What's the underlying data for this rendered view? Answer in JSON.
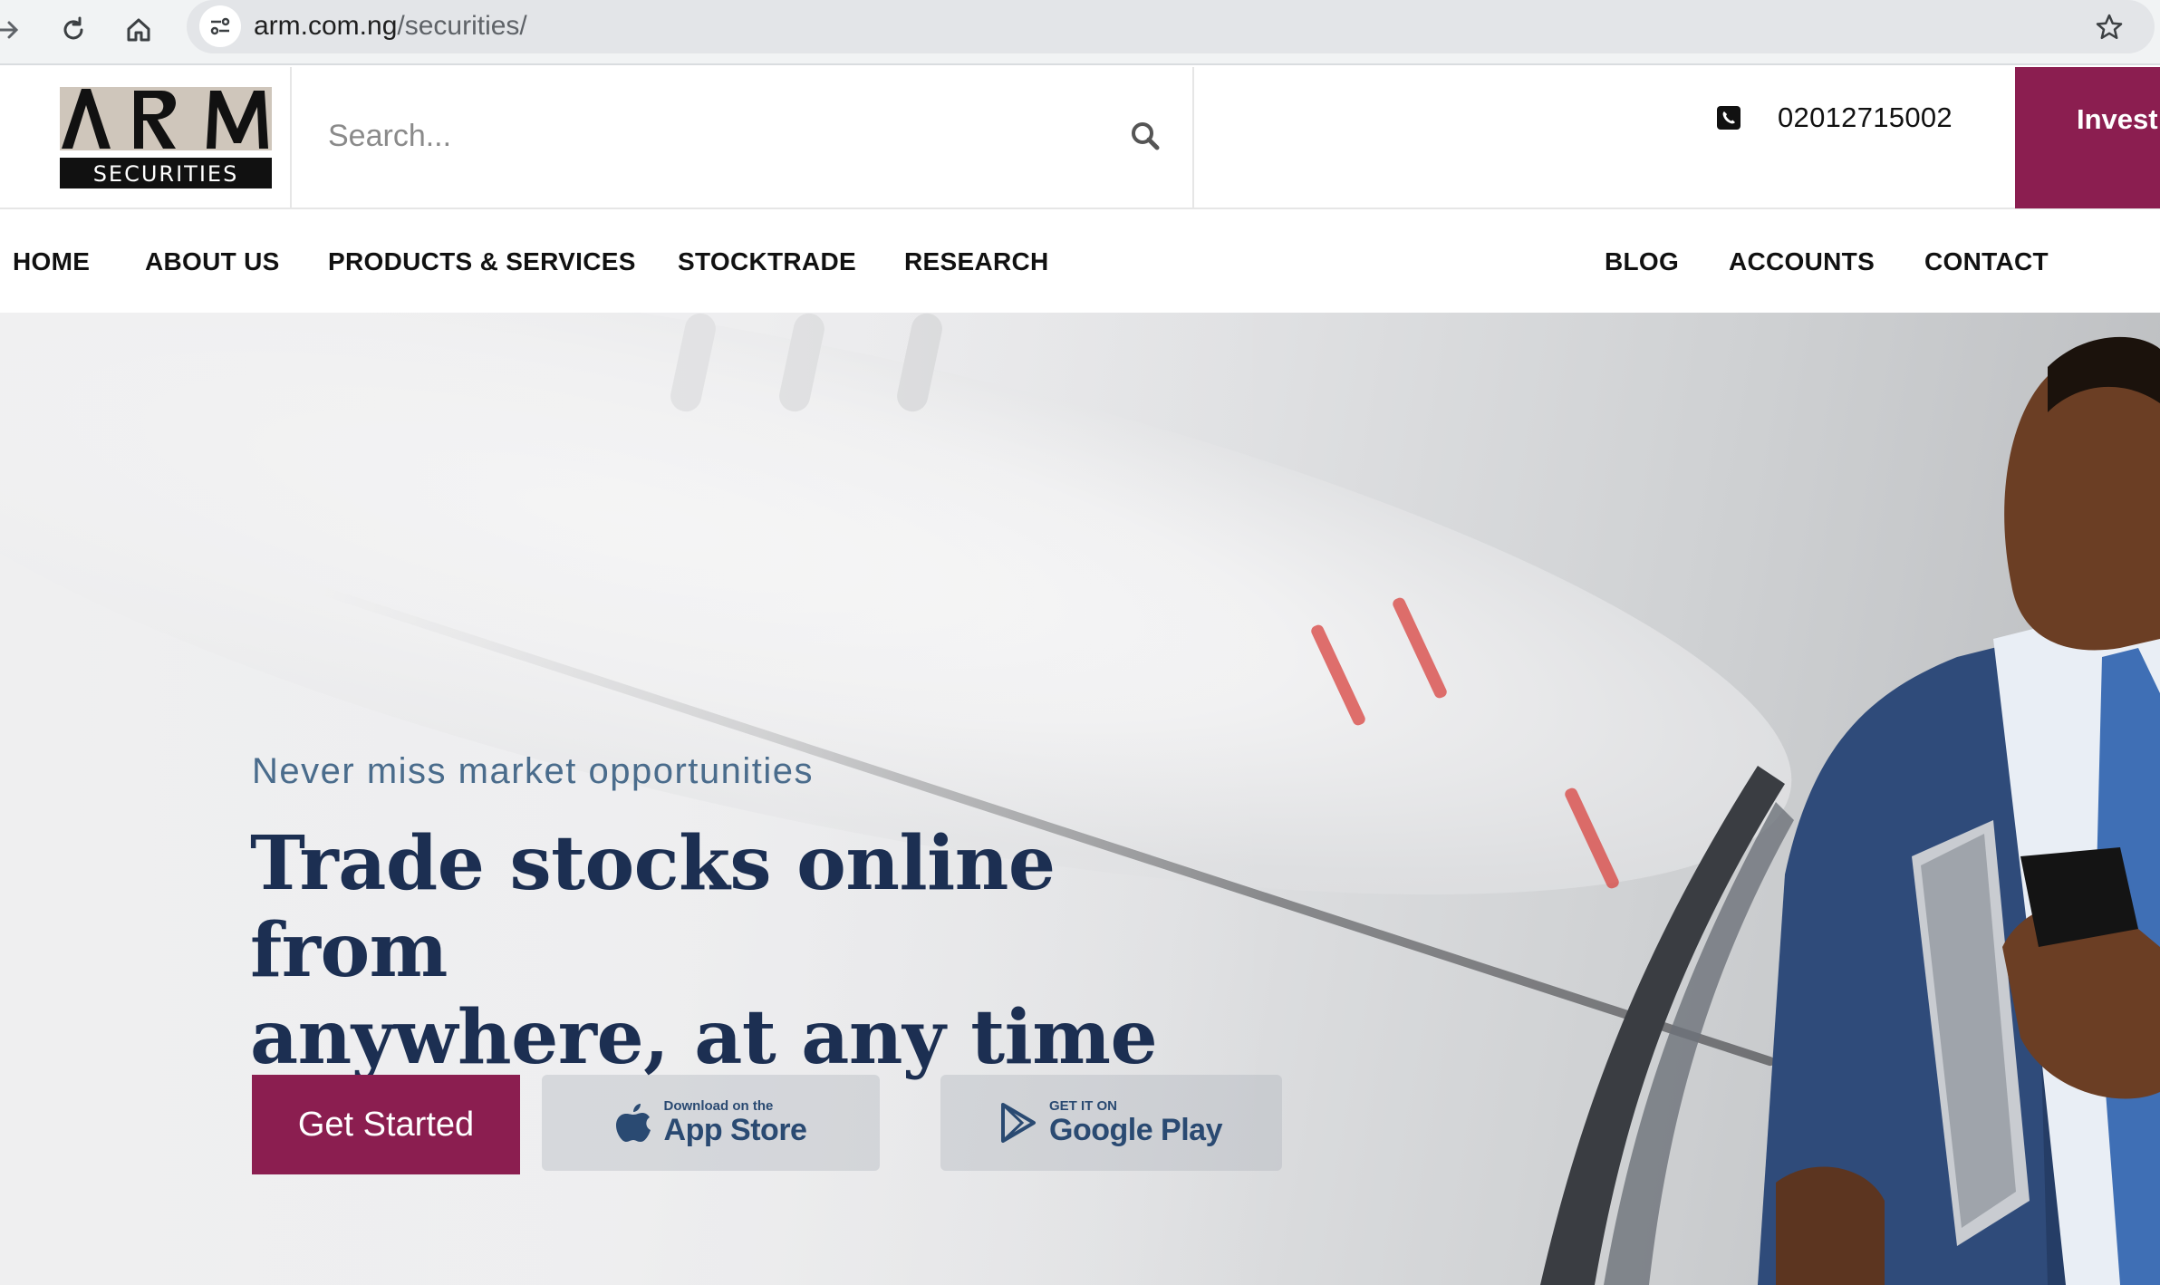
{
  "browser": {
    "url_host": "arm.com.ng",
    "url_path": "/securities/"
  },
  "header": {
    "logo_text": "ARM",
    "logo_subtext": "SECURITIES",
    "search_placeholder": "Search...",
    "phone": "02012715002",
    "invest_label": "Invest"
  },
  "nav": {
    "items": [
      "HOME",
      "ABOUT US",
      "PRODUCTS & SERVICES",
      "STOCKTRADE",
      "RESEARCH",
      "BLOG",
      "ACCOUNTS",
      "CONTACT"
    ]
  },
  "hero": {
    "subtitle": "Never miss market opportunities",
    "title_line1": "Trade stocks online from",
    "title_line2": "anywhere, at any time",
    "cta_label": "Get Started",
    "app_store_small": "Download on the",
    "app_store_big": "App Store",
    "google_play_small": "GET IT ON",
    "google_play_big": "Google Play"
  },
  "colors": {
    "brand": "#8b1e50",
    "title": "#1c2f52",
    "subtitle": "#4a6c8c"
  },
  "icons": [
    "back-arrow-icon",
    "reload-icon",
    "home-icon",
    "site-info-icon",
    "bookmark-star-icon",
    "search-icon",
    "phone-icon",
    "apple-icon",
    "google-play-icon"
  ]
}
